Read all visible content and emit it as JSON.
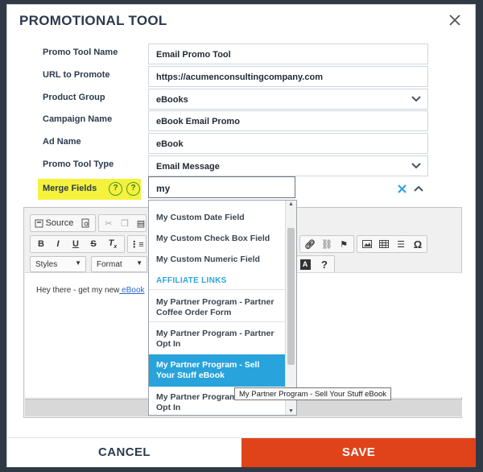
{
  "modal": {
    "title": "PROMOTIONAL TOOL"
  },
  "fields": {
    "promo_tool_name": {
      "label": "Promo Tool Name",
      "value": "Email Promo Tool"
    },
    "url_to_promote": {
      "label": "URL to Promote",
      "value": "https://acumenconsultingcompany.com"
    },
    "product_group": {
      "label": "Product Group",
      "value": "eBooks"
    },
    "campaign_name": {
      "label": "Campaign Name",
      "value": "eBook Email Promo"
    },
    "ad_name": {
      "label": "Ad Name",
      "value": "eBook"
    },
    "promo_tool_type": {
      "label": "Promo Tool Type",
      "value": "Email Message"
    },
    "merge_fields": {
      "label": "Merge Fields",
      "value": "my",
      "help1": "?",
      "help2": "?"
    }
  },
  "editor": {
    "source_label": "Source",
    "styles_label": "Styles",
    "format_label": "Format",
    "content_prefix": "Hey there - get my new",
    "content_link": " eBook"
  },
  "dropdown": {
    "items_top": [
      "My Custom Date Field",
      "My Custom Check Box Field",
      "My Custom Numeric Field"
    ],
    "affiliate_header": "AFFILIATE LINKS",
    "affiliate_items": [
      "My Partner Program - Partner Coffee Order Form",
      "My Partner Program - Partner Opt In",
      "My Partner Program - Sell Your Stuff eBook",
      "My Partner Program - Partner Opt In"
    ],
    "tooltip": "My Partner Program - Sell Your Stuff eBook"
  },
  "footer": {
    "cancel_label": "CANCEL",
    "save_label": "SAVE"
  },
  "colors": {
    "accent": "#28a3db",
    "save": "#e0431a",
    "highlight": "#f5f23d"
  }
}
